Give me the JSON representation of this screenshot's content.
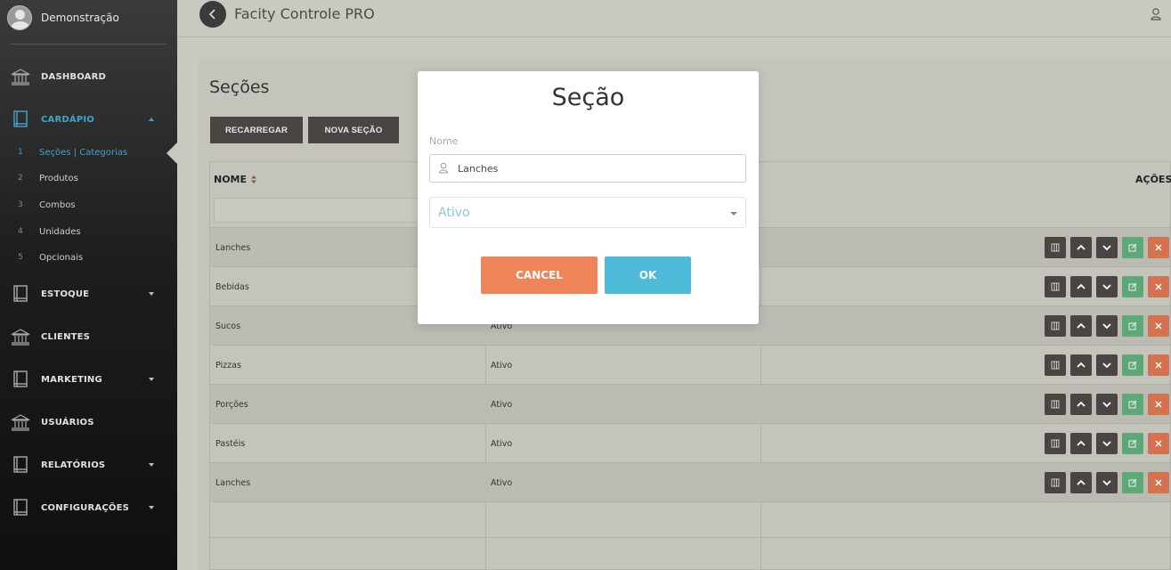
{
  "profile": {
    "name": "Demonstração"
  },
  "sidebar": {
    "items": [
      {
        "label": "DASHBOARD",
        "icon": "bank-icon"
      },
      {
        "label": "CARDÁPIO",
        "icon": "book-icon"
      },
      {
        "label": "ESTOQUE",
        "icon": "book-icon"
      },
      {
        "label": "CLIENTES",
        "icon": "bank-icon"
      },
      {
        "label": "MARKETING",
        "icon": "book-icon"
      },
      {
        "label": "USUÁRIOS",
        "icon": "bank-icon"
      },
      {
        "label": "RELATÓRIOS",
        "icon": "book-icon"
      },
      {
        "label": "CONFIGURAÇÕES",
        "icon": "book-icon"
      }
    ],
    "subitems": [
      {
        "num": "1",
        "label": "Seções | Categorias"
      },
      {
        "num": "2",
        "label": "Produtos"
      },
      {
        "num": "3",
        "label": "Combos"
      },
      {
        "num": "4",
        "label": "Unidades"
      },
      {
        "num": "5",
        "label": "Opcionais"
      }
    ]
  },
  "header": {
    "title": "Facity Controle PRO"
  },
  "page": {
    "title": "Seções",
    "reload_label": "RECARREGAR",
    "new_label": "NOVA SEÇÃO"
  },
  "table": {
    "col_name": "NOME",
    "col_actions": "AÇÕES",
    "rows": [
      {
        "name": "Lanches",
        "status": ""
      },
      {
        "name": "Bebidas",
        "status": ""
      },
      {
        "name": "Sucos",
        "status": "Ativo"
      },
      {
        "name": "Pizzas",
        "status": "Ativo"
      },
      {
        "name": "Porções",
        "status": "Ativo"
      },
      {
        "name": "Pastéis",
        "status": "Ativo"
      },
      {
        "name": "Lanches",
        "status": "Ativo"
      }
    ]
  },
  "modal": {
    "title": "Seção",
    "name_label": "Nome",
    "name_value": "Lanches",
    "status_value": "Ativo",
    "cancel_label": "CANCEL",
    "ok_label": "OK"
  },
  "colors": {
    "accent": "#3ea6c8",
    "cancel": "#f08459",
    "ok": "#4fbbda",
    "edit": "#5ea777",
    "delete": "#d4714e"
  }
}
